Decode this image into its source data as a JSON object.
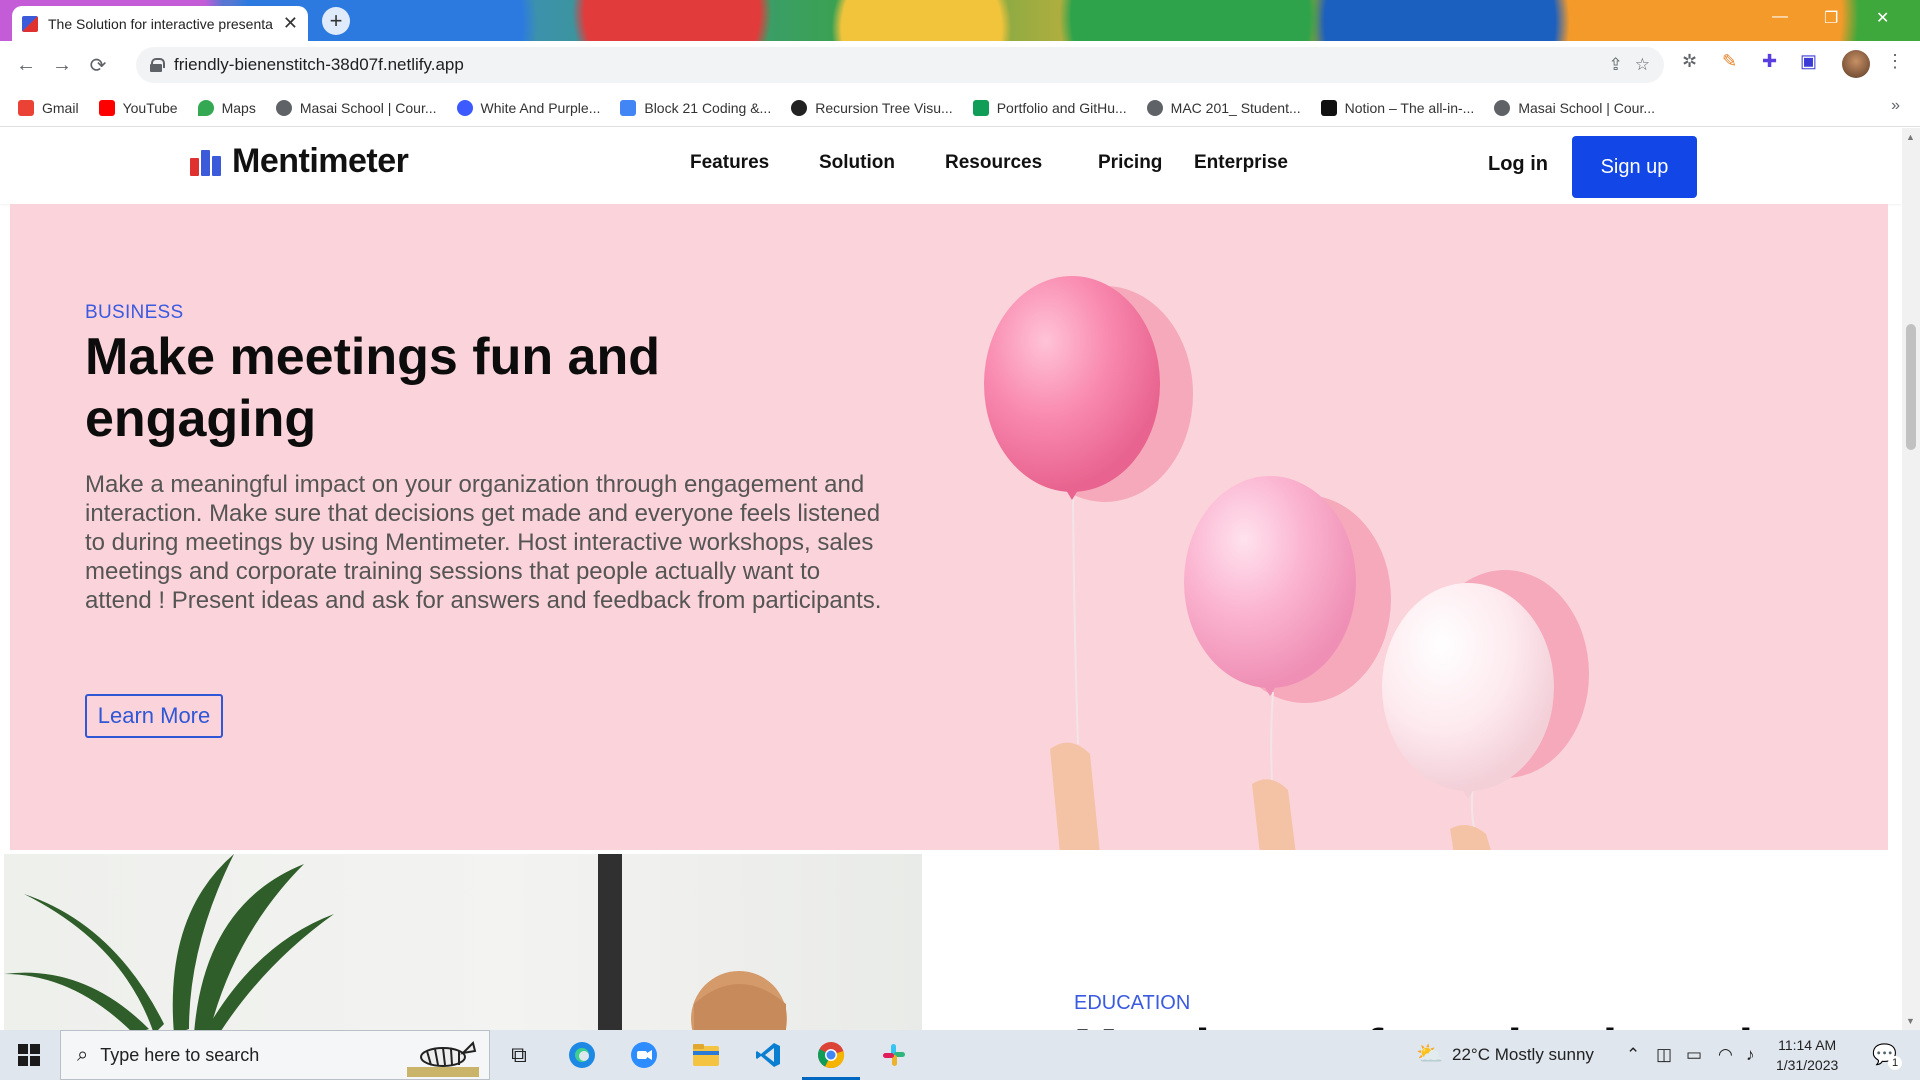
{
  "browser": {
    "tab_title": "The Solution for interactive presentations",
    "url": "friendly-bienenstitch-38d07f.netlify.app",
    "bookmarks": [
      {
        "label": "Gmail",
        "color": "#ea4335"
      },
      {
        "label": "YouTube",
        "color": "#ff0000"
      },
      {
        "label": "Maps",
        "color": "#34a853"
      },
      {
        "label": "Masai School | Cour...",
        "color": "#5f6368"
      },
      {
        "label": "White And Purple...",
        "color": "#3d5afe"
      },
      {
        "label": "Block 21 Coding &...",
        "color": "#4285f4"
      },
      {
        "label": "Recursion Tree Visu...",
        "color": "#222222"
      },
      {
        "label": "Portfolio and GitHu...",
        "color": "#0f9d58"
      },
      {
        "label": "MAC 201_ Student...",
        "color": "#5f6368"
      },
      {
        "label": "Notion – The all-in-...",
        "color": "#111111"
      },
      {
        "label": "Masai School | Cour...",
        "color": "#5f6368"
      }
    ]
  },
  "site": {
    "logo_text": "Mentimeter",
    "nav": [
      "Features",
      "Solution",
      "Resources",
      "Pricing",
      "Enterprise"
    ],
    "login": "Log in",
    "signup": "Sign up",
    "accent": "#1246e6"
  },
  "hero": {
    "eyebrow": "BUSINESS",
    "title": "Make meetings fun and engaging",
    "body": "Make a meaningful impact on your organization through engagement and interaction. Make sure that decisions get made and everyone feels listened to during meetings by using Mentimeter. Host interactive workshops, sales meetings and corporate training sessions that people actually want to attend ! Present ideas and ask for answers and feedback from participants.",
    "cta": "Learn More",
    "background": "#fbd3da"
  },
  "education": {
    "eyebrow": "EDUCATION",
    "title_partial": "Mentimeter for schools and"
  },
  "taskbar": {
    "search_placeholder": "Type here to search",
    "weather": "22°C  Mostly sunny",
    "time": "11:14 AM",
    "date": "1/31/2023",
    "notification_count": "1"
  }
}
